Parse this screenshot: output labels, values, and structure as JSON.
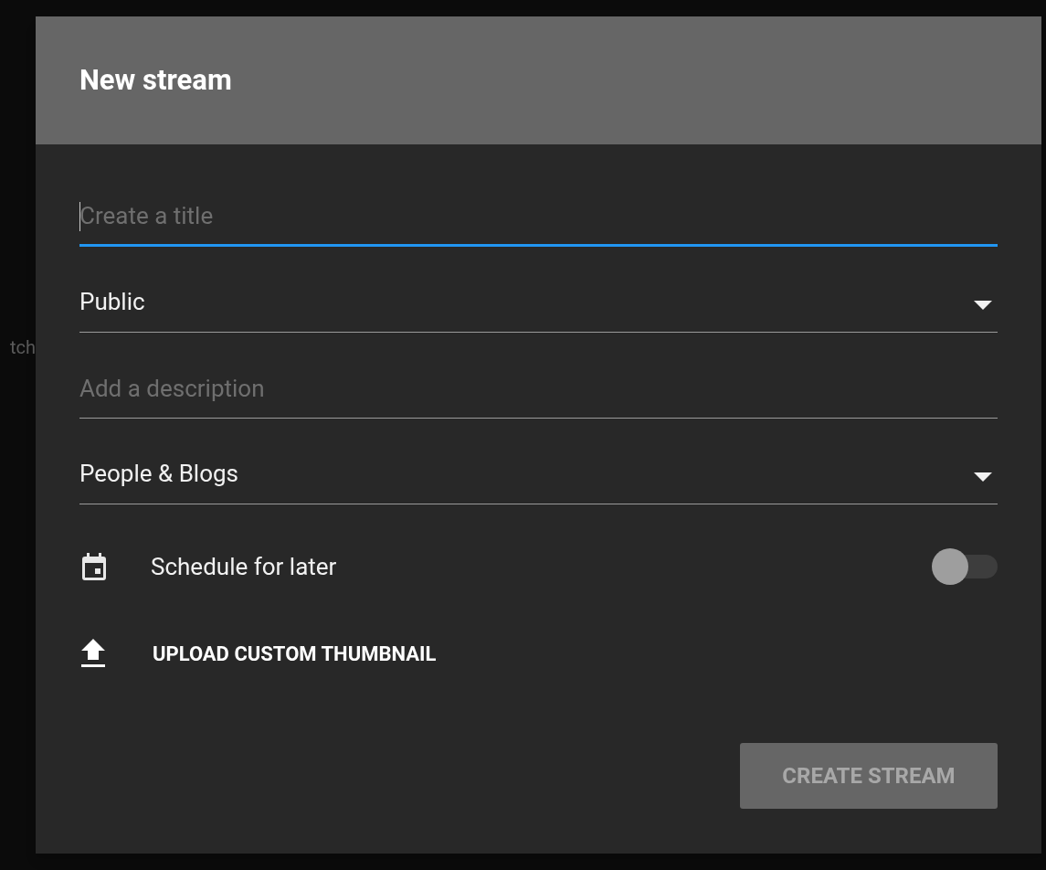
{
  "background": {
    "text": "tch"
  },
  "dialog": {
    "title": "New stream",
    "fields": [
      {
        "kind": "text",
        "placeholder": "Create a title",
        "focused": true
      },
      {
        "kind": "select",
        "value": "Public"
      },
      {
        "kind": "text",
        "placeholder": "Add a description",
        "focused": false
      },
      {
        "kind": "select",
        "value": "People & Blogs"
      }
    ],
    "schedule": {
      "label": "Schedule for later",
      "on": false
    },
    "upload": {
      "label": "UPLOAD CUSTOM THUMBNAIL"
    },
    "create_button": {
      "label": "CREATE STREAM",
      "disabled": true
    }
  }
}
